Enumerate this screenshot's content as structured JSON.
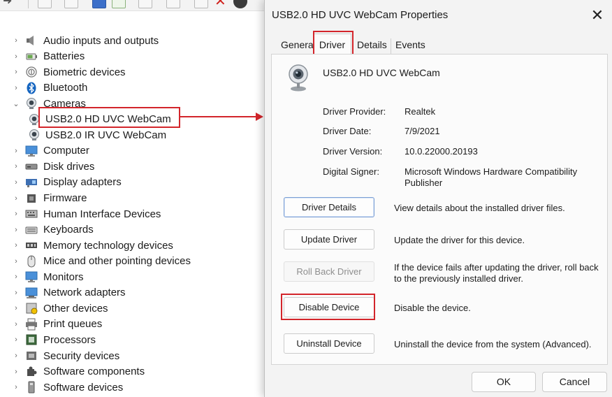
{
  "device_manager": {
    "tree": [
      {
        "label": "Audio inputs and outputs",
        "icon": "speaker-icon",
        "expanded": false
      },
      {
        "label": "Batteries",
        "icon": "battery-icon",
        "expanded": false
      },
      {
        "label": "Biometric devices",
        "icon": "fingerprint-icon",
        "expanded": false
      },
      {
        "label": "Bluetooth",
        "icon": "bluetooth-icon",
        "expanded": false
      },
      {
        "label": "Cameras",
        "icon": "webcam-icon",
        "expanded": true
      },
      {
        "label": "USB2.0 HD UVC WebCam",
        "icon": "webcam-icon",
        "child": true,
        "selected": true
      },
      {
        "label": "USB2.0 IR UVC WebCam",
        "icon": "webcam-icon",
        "child": true
      },
      {
        "label": "Computer",
        "icon": "monitor-icon",
        "expanded": false
      },
      {
        "label": "Disk drives",
        "icon": "disk-drive-icon",
        "expanded": false
      },
      {
        "label": "Display adapters",
        "icon": "display-adapter-icon",
        "expanded": false
      },
      {
        "label": "Firmware",
        "icon": "chip-icon",
        "expanded": false
      },
      {
        "label": "Human Interface Devices",
        "icon": "hid-icon",
        "expanded": false
      },
      {
        "label": "Keyboards",
        "icon": "keyboard-icon",
        "expanded": false
      },
      {
        "label": "Memory technology devices",
        "icon": "memory-icon",
        "expanded": false
      },
      {
        "label": "Mice and other pointing devices",
        "icon": "mouse-icon",
        "expanded": false
      },
      {
        "label": "Monitors",
        "icon": "monitor-icon",
        "expanded": false
      },
      {
        "label": "Network adapters",
        "icon": "network-icon",
        "expanded": false
      },
      {
        "label": "Other devices",
        "icon": "unknown-device-icon",
        "expanded": false
      },
      {
        "label": "Print queues",
        "icon": "printer-icon",
        "expanded": false
      },
      {
        "label": "Processors",
        "icon": "processor-icon",
        "expanded": false
      },
      {
        "label": "Security devices",
        "icon": "security-icon",
        "expanded": false
      },
      {
        "label": "Software components",
        "icon": "puzzle-icon",
        "expanded": false
      },
      {
        "label": "Software devices",
        "icon": "software-device-icon",
        "expanded": false
      }
    ]
  },
  "dialog": {
    "title": "USB2.0 HD UVC WebCam Properties",
    "close_symbol": "✕",
    "tabs": [
      {
        "label": "General",
        "active": false
      },
      {
        "label": "Driver",
        "active": true
      },
      {
        "label": "Details",
        "active": false
      },
      {
        "label": "Events",
        "active": false
      }
    ],
    "device_name": "USB2.0 HD UVC WebCam",
    "properties": [
      {
        "label": "Driver Provider:",
        "value": "Realtek"
      },
      {
        "label": "Driver Date:",
        "value": "7/9/2021"
      },
      {
        "label": "Driver Version:",
        "value": "10.0.22000.20193"
      },
      {
        "label": "Digital Signer:",
        "value": "Microsoft Windows Hardware Compatibility Publisher"
      }
    ],
    "actions": [
      {
        "label": "Driver Details",
        "description": "View details about the installed driver files.",
        "enabled": true
      },
      {
        "label": "Update Driver",
        "description": "Update the driver for this device.",
        "enabled": true
      },
      {
        "label": "Roll Back Driver",
        "description": "If the device fails after updating the driver, roll back to the previously installed driver.",
        "enabled": false
      },
      {
        "label": "Disable Device",
        "description": "Disable the device.",
        "enabled": true
      },
      {
        "label": "Uninstall Device",
        "description": "Uninstall the device from the system (Advanced).",
        "enabled": true
      }
    ],
    "ok_label": "OK",
    "cancel_label": "Cancel"
  },
  "colors": {
    "highlight_red": "#d3252b",
    "dialog_bg": "#f3f3f3",
    "panel_bg": "#fbfbfb",
    "focus_border": "#7a9ed4"
  }
}
